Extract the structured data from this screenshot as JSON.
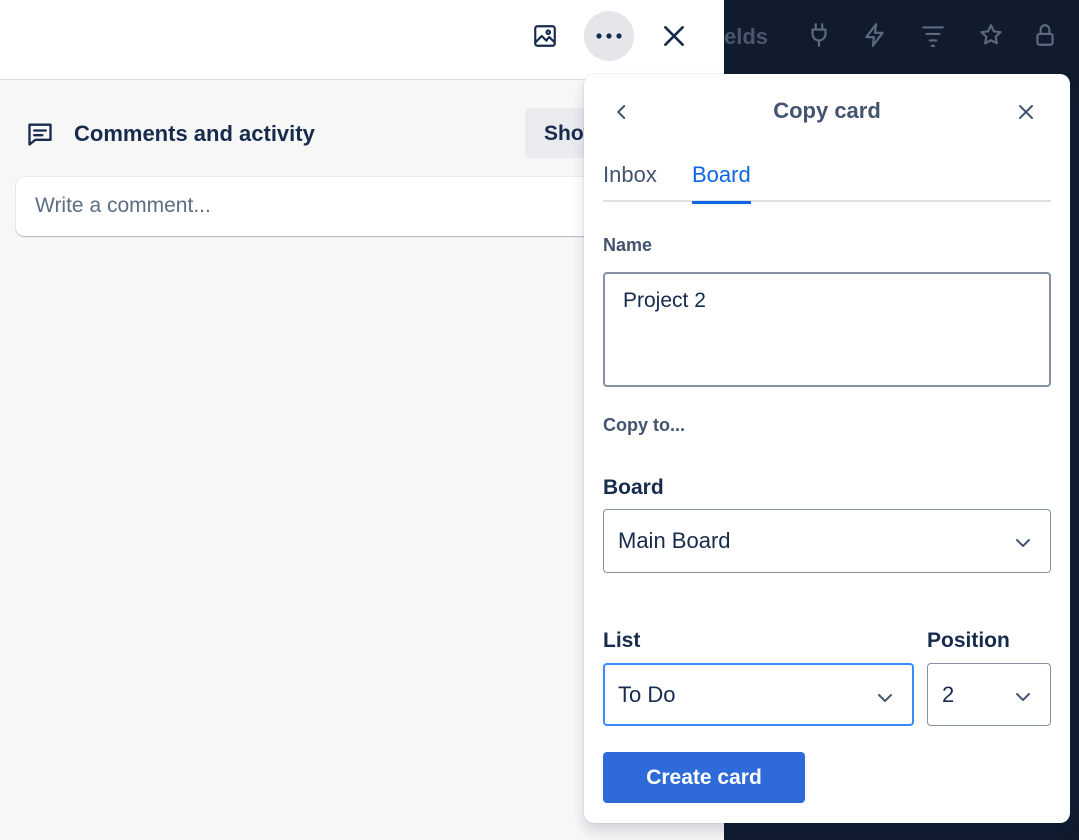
{
  "board_toolbar": {
    "fields_label": "elds",
    "icons": [
      "power-up-plug-icon",
      "automation-bolt-icon",
      "filter-icon",
      "star-icon",
      "lock-icon"
    ]
  },
  "card_header": {
    "icons": [
      "cover-image-icon",
      "more-actions-icon",
      "close-icon"
    ]
  },
  "activity": {
    "title": "Comments and activity",
    "show_button": "Show details",
    "comment_placeholder": "Write a comment..."
  },
  "copy_card": {
    "title": "Copy card",
    "tabs": [
      {
        "label": "Inbox",
        "active": false
      },
      {
        "label": "Board",
        "active": true
      }
    ],
    "name_label": "Name",
    "name_value": "Project 2",
    "copy_to_label": "Copy to...",
    "board_label": "Board",
    "board_value": "Main Board",
    "list_label": "List",
    "list_value": "To Do",
    "position_label": "Position",
    "position_value": "2",
    "create_button": "Create card"
  },
  "colors": {
    "primary": "#2e6bd9",
    "link": "#0c66e4",
    "focus_border": "#388bff",
    "board_background": "#101c2e",
    "text": "#172b4d",
    "subtle_text": "#44546f"
  }
}
